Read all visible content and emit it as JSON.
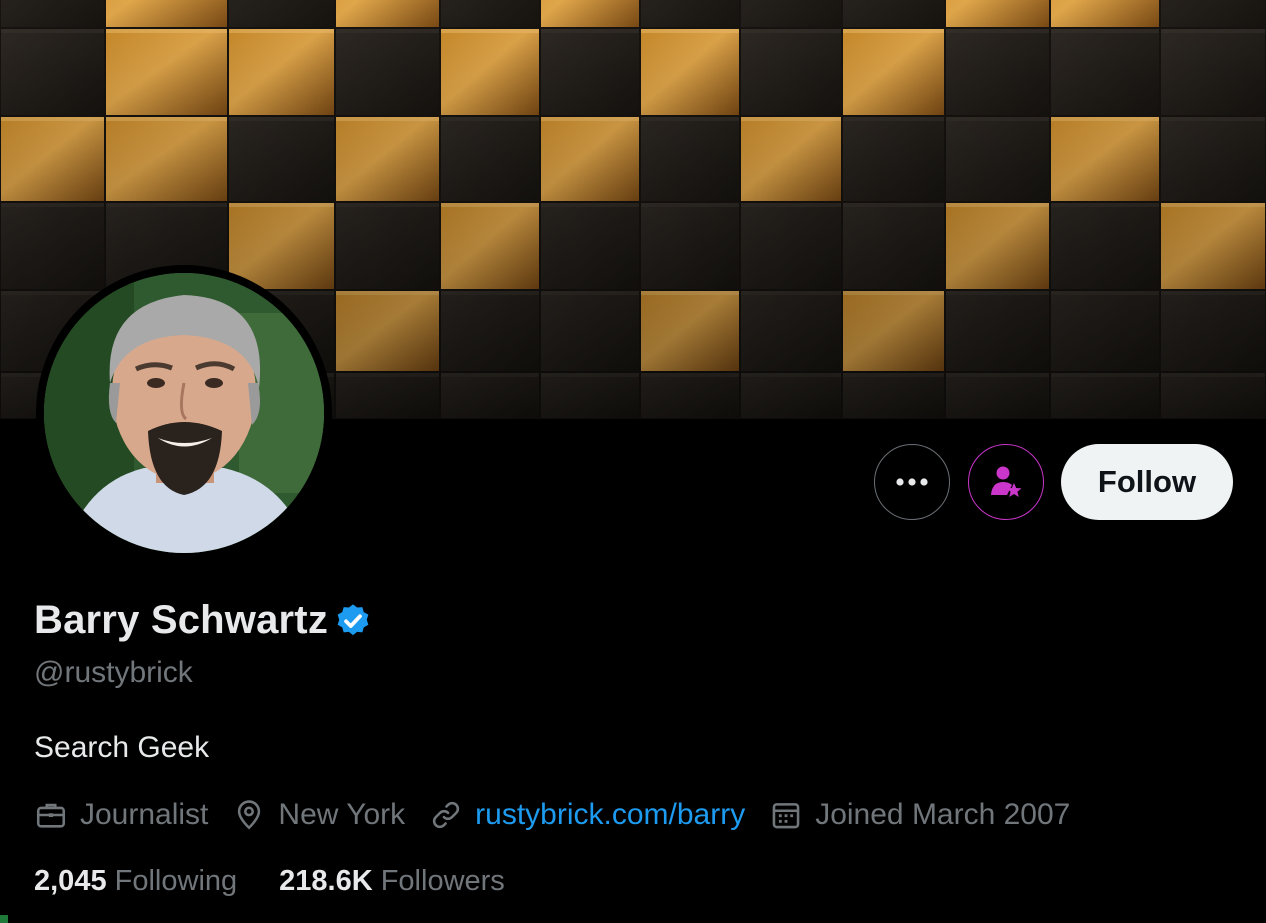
{
  "profile": {
    "name": "Barry Schwartz",
    "handle": "@rustybrick",
    "bio": "Search Geek",
    "verified": true,
    "verified_color": "#1d9bf0"
  },
  "actions": {
    "more_icon": "more-horizontal-icon",
    "subscribe_icon": "person-star-icon",
    "subscribe_accent": "#c936c9",
    "follow_label": "Follow"
  },
  "meta": {
    "profession": "Journalist",
    "location": "New York",
    "website": "rustybrick.com/barry",
    "joined": "Joined March 2007",
    "link_color": "#1d9bf0"
  },
  "stats": {
    "following_count": "2,045",
    "following_label": "Following",
    "followers_count": "218.6K",
    "followers_label": "Followers"
  }
}
